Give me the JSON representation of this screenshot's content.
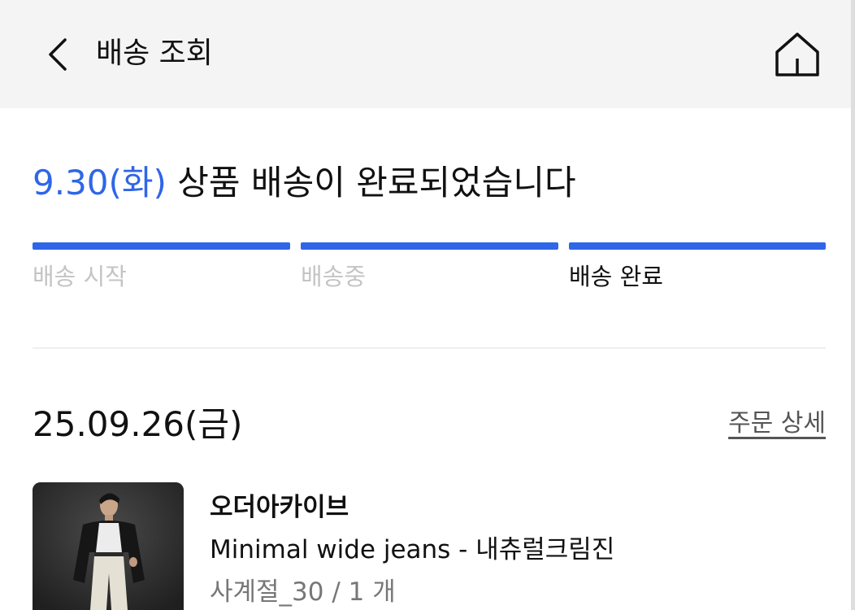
{
  "header": {
    "title": "배송 조회",
    "back_icon": "chevron-left-icon",
    "home_icon": "home-icon",
    "background": "#f4f4f4"
  },
  "delivery_status": {
    "date": "9.30(화)",
    "message": "상품 배송이 완료되었습니다",
    "accent_color": "#2f66e8"
  },
  "progress": {
    "steps": [
      {
        "label": "배송 시작",
        "completed": true,
        "current": false
      },
      {
        "label": "배송중",
        "completed": true,
        "current": false
      },
      {
        "label": "배송 완료",
        "completed": true,
        "current": true
      }
    ],
    "bar_color": "#2f66e8"
  },
  "order": {
    "date": "25.09.26(금)",
    "detail_link": "주문 상세"
  },
  "product": {
    "brand": "오더아카이브",
    "name": "Minimal wide jeans - 내츄럴크림진",
    "option": "사계절_30 / 1 개",
    "image": "product-photo-man-in-black-jacket-white-jeans"
  }
}
